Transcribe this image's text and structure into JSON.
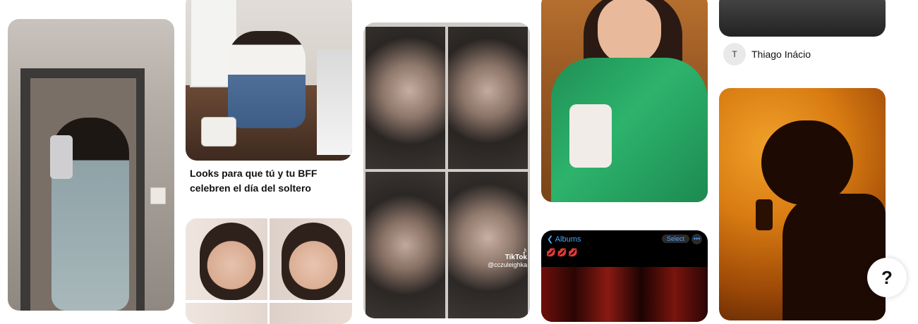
{
  "pins": [
    {
      "id": "pin-mirror-selfie",
      "colors": [
        "#b6b0aa",
        "#5a514a",
        "#8fa0a3"
      ]
    },
    {
      "id": "pin-sitting-floor",
      "colors": [
        "#d8d4cf",
        "#5a3f31",
        "#f2f2f0"
      ]
    },
    {
      "id": "pin-photobooth",
      "colors": [
        "#3b3735",
        "#7a706a",
        "#1f1c1b"
      ]
    },
    {
      "id": "pin-green-blazer",
      "colors": [
        "#c27838",
        "#27a463",
        "#f0e6e0"
      ]
    },
    {
      "id": "pin-silhouette",
      "colors": [
        "#e08a18",
        "#8a3a06",
        "#2a0f03"
      ]
    },
    {
      "id": "pin-dark-top",
      "colors": [
        "#3a3a3a",
        "#1c1c1c"
      ]
    },
    {
      "id": "pin-albums",
      "colors": [
        "#000000",
        "#8c1b14"
      ]
    },
    {
      "id": "pin-two-girls",
      "colors": [
        "#e9ddd6",
        "#3a2b25"
      ]
    }
  ],
  "captions": {
    "looks_title": "Looks para que tú y tu BFF celebren el día del soltero"
  },
  "author": {
    "initial": "T",
    "name": "Thiago Inácio"
  },
  "tiktok": {
    "logo": "TikTok",
    "handle": "@cczuleighka"
  },
  "albums_screen": {
    "back_label": "Albums",
    "select_label": "Select",
    "more_label": "•••",
    "emojis": "💋💋💋"
  },
  "help": {
    "label": "?"
  }
}
